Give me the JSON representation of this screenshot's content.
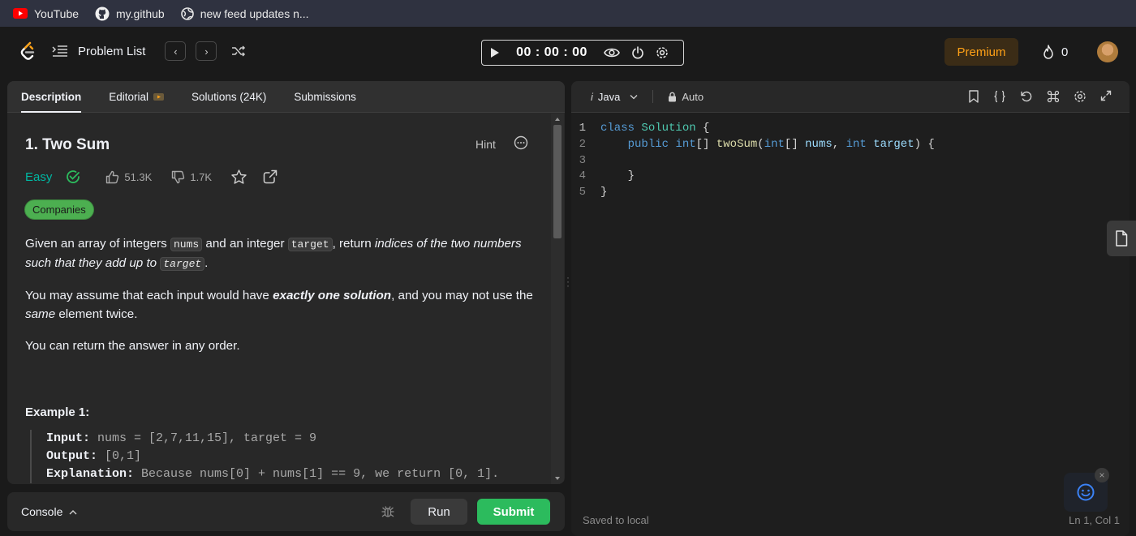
{
  "bookmarks": [
    {
      "label": "YouTube",
      "icon": "youtube-icon"
    },
    {
      "label": "my.github",
      "icon": "github-icon"
    },
    {
      "label": "new feed updates n...",
      "icon": "globe-icon"
    }
  ],
  "nav": {
    "title": "Problem List",
    "timer": "00 : 00 : 00",
    "premium": "Premium",
    "streak_count": "0"
  },
  "problem": {
    "tabs": [
      "Description",
      "Editorial",
      "Solutions (24K)",
      "Submissions"
    ],
    "title": "1. Two Sum",
    "hint": "Hint",
    "difficulty": "Easy",
    "likes": "51.3K",
    "dislikes": "1.7K",
    "companies": "Companies",
    "p1": {
      "a": "Given an array of integers ",
      "code1": "nums",
      "b": " and an integer ",
      "code2": "target",
      "c": ", return ",
      "em": "indices of the two numbers such that they add up to",
      "code3": "target",
      "d": "."
    },
    "p2": {
      "a": "You may assume that each input would have ",
      "strong": "exactly one solution",
      "b": ", and you may not use the ",
      "em": "same",
      "c": " element twice."
    },
    "p3": "You can return the answer in any order.",
    "example_title": "Example 1:",
    "example": {
      "input_label": "Input:",
      "input": " nums = [2,7,11,15], target = 9",
      "output_label": "Output:",
      "output": " [0,1]",
      "explanation_label": "Explanation:",
      "explanation": " Because nums[0] + nums[1] == 9, we return [0, 1]."
    }
  },
  "console": {
    "label": "Console",
    "run": "Run",
    "submit": "Submit"
  },
  "editor": {
    "language": "Java",
    "mode": "Auto",
    "line_numbers": [
      "1",
      "2",
      "3",
      "4",
      "5"
    ],
    "saved": "Saved to local",
    "position": "Ln 1, Col 1"
  },
  "colors": {
    "accent": "#ffa116",
    "easy": "#00b8a3",
    "submit": "#2cbb5d",
    "companies": "#4caf50"
  }
}
